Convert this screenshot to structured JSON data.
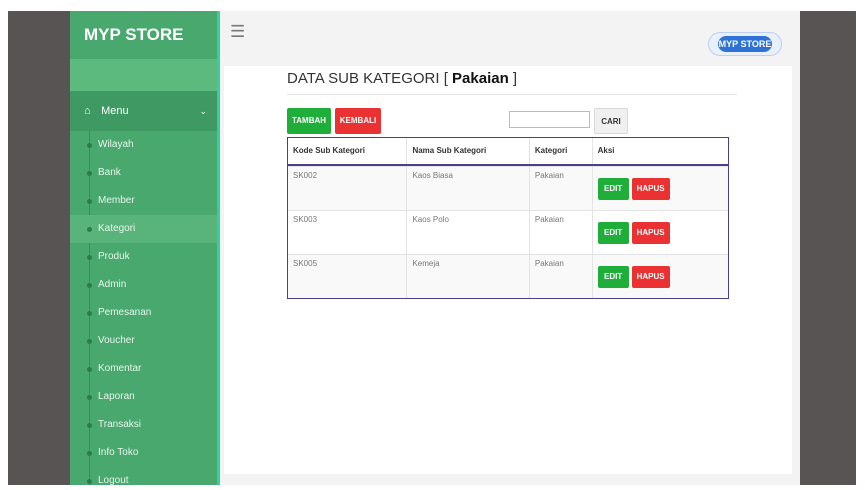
{
  "sidebar": {
    "brand": "MYP STORE",
    "menu_label": "Menu",
    "items": [
      {
        "label": "Wilayah"
      },
      {
        "label": "Bank"
      },
      {
        "label": "Member"
      },
      {
        "label": "Kategori",
        "active": true
      },
      {
        "label": "Produk"
      },
      {
        "label": "Admin"
      },
      {
        "label": "Pemesanan"
      },
      {
        "label": "Voucher"
      },
      {
        "label": "Komentar"
      },
      {
        "label": "Laporan"
      },
      {
        "label": "Transaksi"
      },
      {
        "label": "Info Toko"
      },
      {
        "label": "Logout"
      }
    ]
  },
  "header": {
    "logo_text": "MYP STORE"
  },
  "page": {
    "title_prefix": "DATA SUB KATEGORI [ ",
    "title_category": "Pakaian",
    "title_suffix": " ]"
  },
  "toolbar": {
    "tambah_label": "TAMBAH",
    "kembali_label": "KEMBALI",
    "search_value": "",
    "cari_label": "CARI"
  },
  "table": {
    "columns": [
      "Kode Sub Kategori",
      "Nama Sub Kategori",
      "Kategori",
      "Aksi"
    ],
    "rows": [
      {
        "kode": "SK002",
        "nama": "Kaos Biasa",
        "kategori": "Pakaian"
      },
      {
        "kode": "SK003",
        "nama": "Kaos Polo",
        "kategori": "Pakaian"
      },
      {
        "kode": "SK005",
        "nama": "Kemeja",
        "kategori": "Pakaian"
      }
    ],
    "edit_label": "EDIT",
    "hapus_label": "HAPUS"
  },
  "colors": {
    "sidebar_bg": "#48a86e",
    "accent_green": "#1fae3a",
    "accent_red": "#ea3233",
    "table_border": "#4a3f8f"
  }
}
